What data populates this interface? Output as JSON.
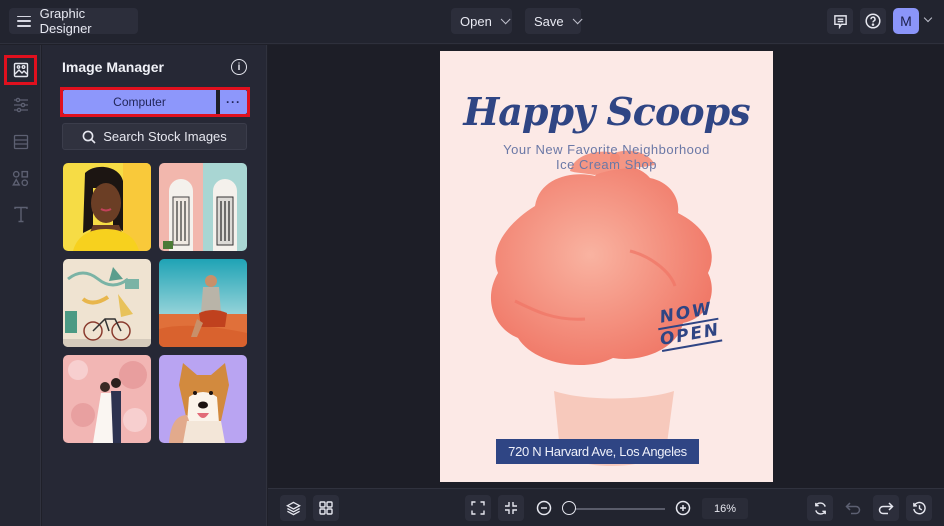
{
  "app": {
    "title": "Graphic Designer"
  },
  "topbar": {
    "open_label": "Open",
    "save_label": "Save",
    "icons": [
      "comments-icon",
      "help-icon"
    ],
    "avatar_initial": "M",
    "accent": "#8b95f9"
  },
  "rail": {
    "items": [
      {
        "name": "image-manager",
        "icon": "image-icon",
        "active": true
      },
      {
        "name": "adjustments",
        "icon": "sliders-icon",
        "active": false
      },
      {
        "name": "layouts",
        "icon": "layout-icon",
        "active": false
      },
      {
        "name": "graphics",
        "icon": "shapes-icon",
        "active": false
      },
      {
        "name": "text",
        "icon": "text-icon",
        "active": false
      }
    ]
  },
  "panel": {
    "title": "Image Manager",
    "computer_label": "Computer",
    "more_label": "···",
    "search_stock_label": "Search Stock Images",
    "thumbnails": [
      {
        "name": "woman-yellow-background"
      },
      {
        "name": "pastel-doorways"
      },
      {
        "name": "bicycle-mural"
      },
      {
        "name": "man-sitting-desert"
      },
      {
        "name": "wedding-couple-blossoms"
      },
      {
        "name": "shiba-inu-dog"
      }
    ]
  },
  "poster": {
    "title": "Happy Scoops",
    "subtitle_line1": "Your New Favorite Neighborhood",
    "subtitle_line2": "Ice Cream Shop",
    "badge_line1": "NOW",
    "badge_line2": "OPEN",
    "address": "720 N Harvard Ave, Los Angeles",
    "colors": {
      "background": "#fce9e6",
      "navy": "#2f4584",
      "ice_cream": "#f27f6e"
    }
  },
  "bottombar": {
    "zoom_value": "16%",
    "zoom_fraction": 0.02
  }
}
